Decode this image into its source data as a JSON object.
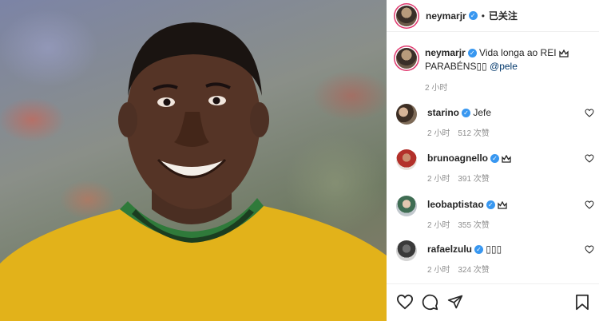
{
  "header": {
    "username": "neymarjr",
    "separator": "•",
    "follow_label": "已关注"
  },
  "caption": {
    "username": "neymarjr",
    "text_line1": "Vida longa ao REI",
    "text_line2": "PARABÉNS▯▯",
    "mention": "@pele",
    "time": "2 小时"
  },
  "comments": [
    {
      "username": "starino",
      "text": "Jefe",
      "time": "2 小时",
      "likes": "512 次赞"
    },
    {
      "username": "brunoagnello",
      "text": "",
      "time": "2 小时",
      "likes": "391 次赞"
    },
    {
      "username": "leobaptistao",
      "text": "",
      "time": "2 小时",
      "likes": "355 次赞"
    },
    {
      "username": "rafaelzulu",
      "text": "▯▯▯",
      "time": "2 小时",
      "likes": "324 次赞"
    }
  ],
  "icons": {
    "verified": "verified-badge-icon",
    "crown": "crown-icon",
    "heart": "heart-icon",
    "comment": "comment-icon",
    "share": "share-icon",
    "save": "bookmark-icon"
  },
  "colors": {
    "verified": "#3897f0",
    "story_ring": "#e03a6f",
    "mention": "#00376b",
    "meta": "#8e8e8e"
  }
}
